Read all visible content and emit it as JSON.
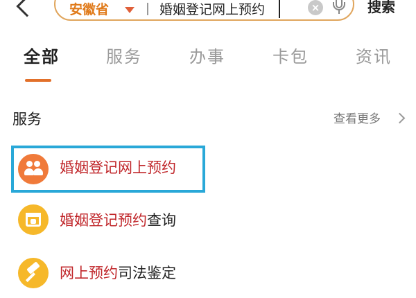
{
  "header": {
    "back_icon": "chevron-left-icon",
    "region": "安徽省",
    "query": "婚姻登记网上预约",
    "clear_icon": "clear-icon",
    "mic_icon": "microphone-icon",
    "search_button": "搜索"
  },
  "tabs": [
    {
      "label": "全部",
      "active": true
    },
    {
      "label": "服务",
      "active": false
    },
    {
      "label": "办事",
      "active": false
    },
    {
      "label": "卡包",
      "active": false
    },
    {
      "label": "资讯",
      "active": false
    }
  ],
  "section": {
    "title": "服务",
    "more": "查看更多"
  },
  "results": [
    {
      "label": "婚姻登记网上预约",
      "icon": "people-icon",
      "color": "#f07a3a",
      "highlighted": true
    },
    {
      "label_red": "婚姻登记预约",
      "label_dark": "查询",
      "icon": "calendar-heart-icon",
      "color": "#f6b82a",
      "highlighted": false
    },
    {
      "label_red": "网上预约",
      "label_dark": "司法鉴定",
      "icon": "gavel-icon",
      "color": "#f6b82a",
      "highlighted": false
    }
  ],
  "colors": {
    "accent": "#e2702a",
    "highlight_border": "#29a8d8",
    "match_text": "#c0262a"
  }
}
